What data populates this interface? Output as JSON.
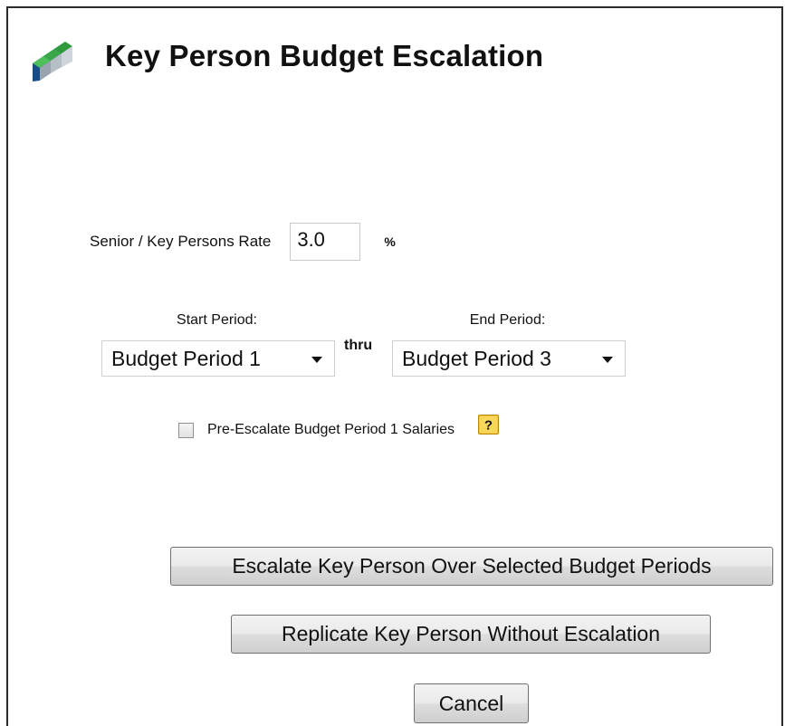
{
  "dialog": {
    "title": "Key Person Budget Escalation",
    "title_icon": "staircase-icon"
  },
  "rate": {
    "label": "Senior / Key Persons Rate",
    "value": "3.0",
    "unit": "%"
  },
  "periods": {
    "start_label": "Start Period:",
    "start_value": "Budget Period 1",
    "thru_label": "thru",
    "end_label": "End Period:",
    "end_value": "Budget Period 3"
  },
  "pre_escalate": {
    "label": "Pre-Escalate Budget Period 1 Salaries",
    "checked": false,
    "help_icon": "help-question-icon",
    "help_glyph": "?"
  },
  "buttons": {
    "escalate": "Escalate Key Person Over Selected Budget Periods",
    "replicate": "Replicate Key Person Without Escalation",
    "cancel": "Cancel"
  },
  "colors": {
    "icon_blue": "#1f6fb8",
    "icon_green": "#3aa848",
    "help_yellow": "#f5c93a"
  }
}
